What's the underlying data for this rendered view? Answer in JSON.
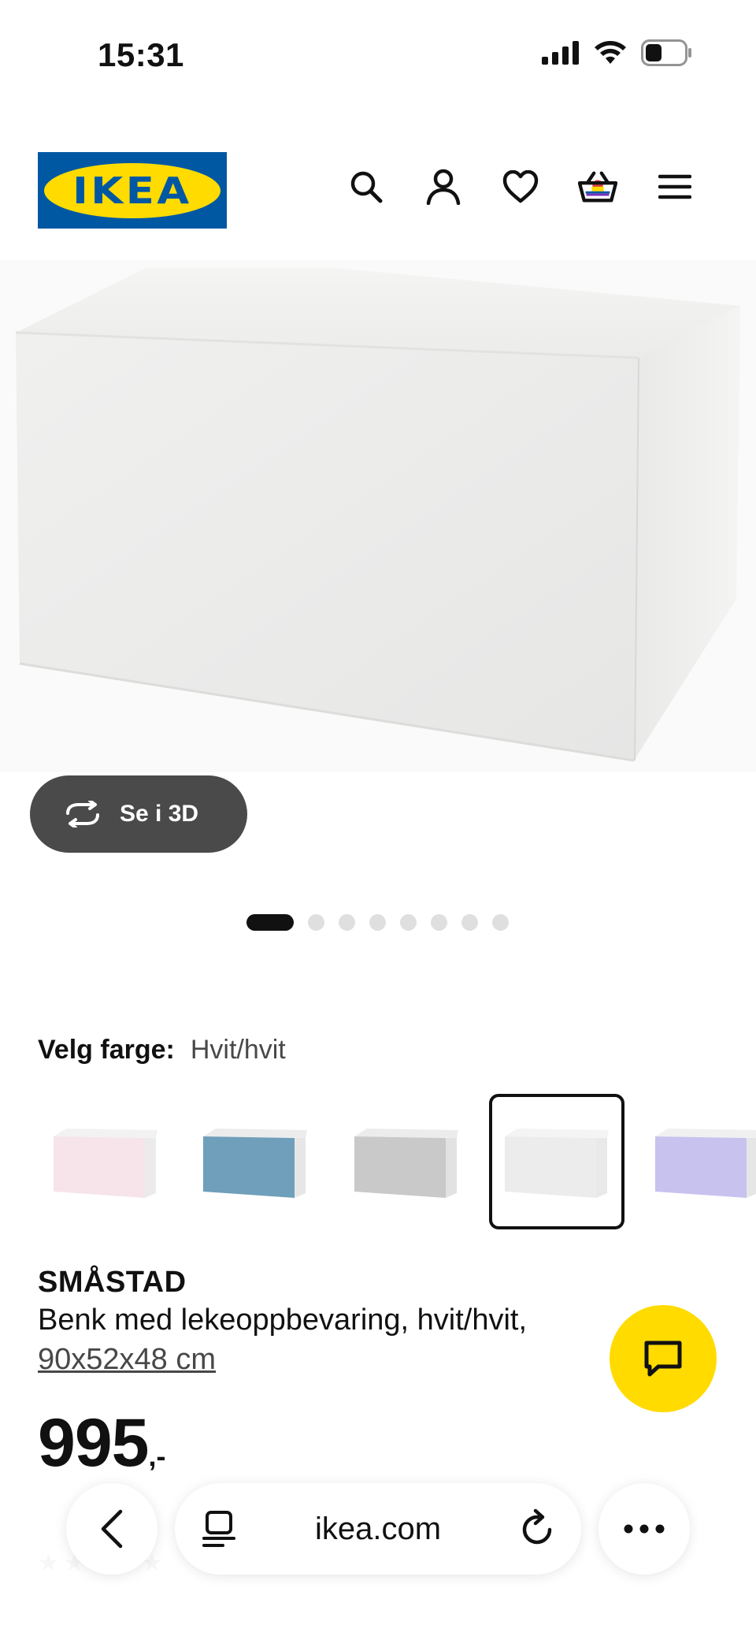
{
  "status_bar": {
    "time": "15:31"
  },
  "header": {
    "logo_text": "IKEA",
    "icons": [
      "search-icon",
      "account-icon",
      "heart-icon",
      "basket-icon",
      "menu-icon"
    ]
  },
  "gallery": {
    "see_3d_label": "Se i 3D",
    "dot_count": 8,
    "active_index": 0
  },
  "color_picker": {
    "label": "Velg farge:",
    "value": "Hvit/hvit",
    "swatches": [
      {
        "color": "#f6e4ea",
        "selected": false
      },
      {
        "color": "#6f9fba",
        "selected": false
      },
      {
        "color": "#c9c9c9",
        "selected": false
      },
      {
        "color": "#ececec",
        "selected": true
      },
      {
        "color": "#c7c2ee",
        "selected": false
      }
    ]
  },
  "product": {
    "brand": "SMÅSTAD",
    "description": "Benk med lekeoppbevaring, hvit/hvit,",
    "size": "90x52x48 cm",
    "price_main": "995",
    "price_suffix": ",-"
  },
  "browser": {
    "url": "ikea.com"
  },
  "colors": {
    "ikea_blue": "#0058a3",
    "ikea_yellow": "#ffdb00",
    "button_dark": "#4a4a4a"
  }
}
